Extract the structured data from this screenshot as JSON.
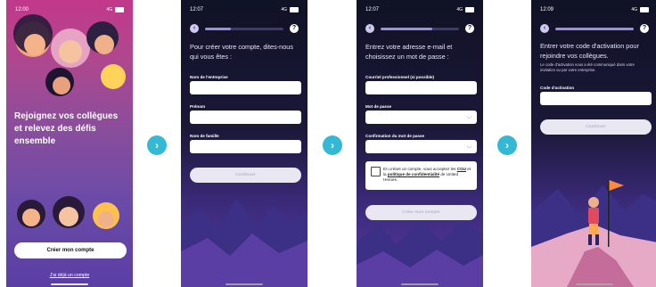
{
  "screen1": {
    "time": "12:00",
    "network": "4G",
    "title": "Rejoignez vos collègues et relevez des défis ensemble",
    "cta": "Créer mon compte",
    "link": "J'ai déjà un compte"
  },
  "screen2": {
    "time": "12:07",
    "network": "4G",
    "progress": 0.33,
    "heading": "Pour créer votre compte, dites-nous qui vous êtes :",
    "fields": [
      "Nom de l'entreprise",
      "Prénom",
      "Nom de famille"
    ],
    "button": "Continuer"
  },
  "screen3": {
    "time": "12:07",
    "network": "4G",
    "progress": 0.66,
    "heading": "Entrez votre adresse e-mail et choisissez un mot de passe :",
    "fields": [
      "Courriel professionnel (si possible)",
      "Mot de passe",
      "Confirmation du mot de passe"
    ],
    "terms_prefix": "En créant un compte, vous acceptez les",
    "terms_cgu": "CGU",
    "terms_mid": "et la",
    "terms_policy": "politique de confidentialité",
    "terms_suffix": "de United Heroes.",
    "button": "Créer mon compte"
  },
  "screen4": {
    "time": "12:09",
    "network": "4G",
    "progress": 1.0,
    "heading": "Entrer votre code d'activation pour rejoindre vos collègues.",
    "note": "Le code d'activation vous a été communiqué dans votre invitation ou par votre entreprise.",
    "field": "Code d'activation",
    "button": "Continuer"
  },
  "arrow_glyph": "›",
  "back_glyph": "‹",
  "help_glyph": "?",
  "eye_glyph": "◡",
  "colors": {
    "accent": "#34b8d3",
    "onboarding_bg": "#c2388b",
    "dark_bg": "#101225",
    "purple": "#5a3aa6"
  }
}
